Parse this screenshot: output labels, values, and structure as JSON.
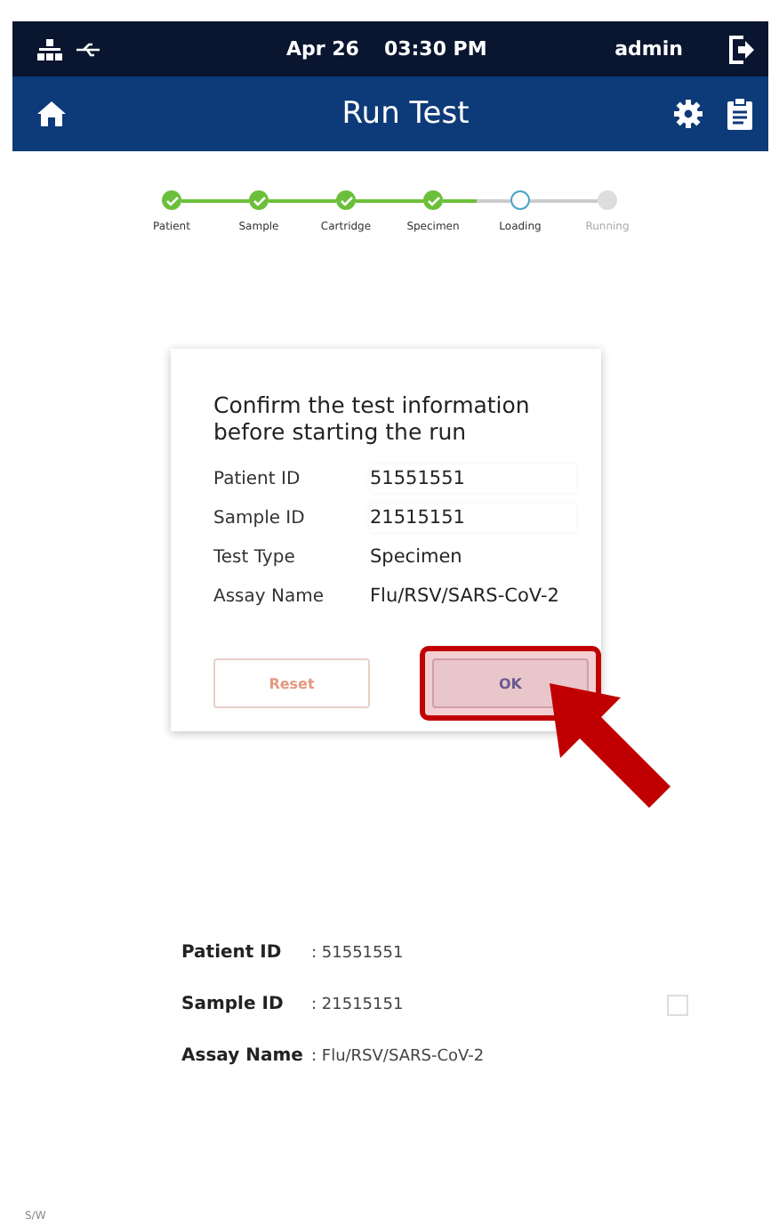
{
  "status_bar": {
    "date": "Apr 26",
    "time": "03:30 PM",
    "user": "admin"
  },
  "header": {
    "title": "Run Test"
  },
  "steps": [
    {
      "label": "Patient",
      "completed": true,
      "selected": false
    },
    {
      "label": "Sample",
      "completed": true,
      "selected": false
    },
    {
      "label": "Cartridge",
      "completed": true,
      "selected": false
    },
    {
      "label": "Specimen",
      "completed": true,
      "selected": false
    },
    {
      "label": "Loading",
      "completed": false,
      "selected": true
    },
    {
      "label": "Running",
      "completed": false,
      "selected": false
    }
  ],
  "dialog": {
    "title": "Confirm the test information before starting the run",
    "fields": [
      {
        "label": "Patient ID",
        "value": "51551551",
        "kind": "field"
      },
      {
        "label": "Sample ID",
        "value": "21515151",
        "kind": "field"
      },
      {
        "label": "Test Type",
        "value": "Specimen",
        "kind": "text"
      },
      {
        "label": "Assay Name",
        "value": "Flu/RSV/SARS-CoV-2",
        "kind": "text"
      }
    ],
    "buttons": [
      {
        "label": "Reset",
        "highlighted": false
      },
      {
        "label": "OK",
        "highlighted": true
      }
    ]
  },
  "summary": [
    {
      "label": "Patient ID",
      "value": ": 51551551"
    },
    {
      "label": "Sample ID",
      "value": ": 21515151",
      "option": {
        "checked": false
      }
    },
    {
      "label": "Assay Name",
      "value": ": Flu/RSV/SARS-CoV-2"
    }
  ],
  "footer": {
    "version": "S/W"
  }
}
